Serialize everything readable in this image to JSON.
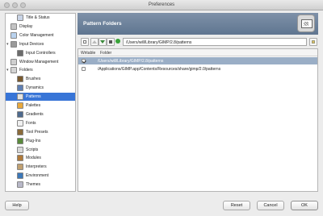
{
  "window": {
    "title": "Preferences"
  },
  "sidebar": {
    "items": [
      {
        "label": "Title & Status",
        "icon": "title-status-icon",
        "color": "#c9d4e6",
        "indent": 1,
        "toggle": ""
      },
      {
        "label": "Display",
        "icon": "display-icon",
        "color": "#c4c4c4",
        "indent": 0,
        "toggle": ""
      },
      {
        "label": "Color Management",
        "icon": "color-management-icon",
        "color": "#b9d2ee",
        "indent": 0,
        "toggle": ""
      },
      {
        "label": "Input Devices",
        "icon": "input-devices-icon",
        "color": "#9a9a9a",
        "indent": 0,
        "toggle": "▾"
      },
      {
        "label": "Input Controllers",
        "icon": "input-controllers-icon",
        "color": "#6b6b6b",
        "indent": 1,
        "toggle": ""
      },
      {
        "label": "Window Management",
        "icon": "window-management-icon",
        "color": "#cfcfcf",
        "indent": 0,
        "toggle": ""
      },
      {
        "label": "Folders",
        "icon": "folders-icon",
        "color": "#d4d4d4",
        "indent": 0,
        "toggle": "▾"
      },
      {
        "label": "Brushes",
        "icon": "brushes-icon",
        "color": "#7a5a2f",
        "indent": 1,
        "toggle": ""
      },
      {
        "label": "Dynamics",
        "icon": "dynamics-icon",
        "color": "#5f7fb3",
        "indent": 1,
        "toggle": ""
      },
      {
        "label": "Patterns",
        "icon": "patterns-icon",
        "color": "#e3e3e3",
        "indent": 1,
        "toggle": ""
      },
      {
        "label": "Palettes",
        "icon": "palettes-icon",
        "color": "#e8a83c",
        "indent": 1,
        "toggle": ""
      },
      {
        "label": "Gradients",
        "icon": "gradients-icon",
        "color": "#4e6a8e",
        "indent": 1,
        "toggle": ""
      },
      {
        "label": "Fonts",
        "icon": "fonts-icon",
        "color": "#f0f0f0",
        "indent": 1,
        "toggle": ""
      },
      {
        "label": "Tool Presets",
        "icon": "tool-presets-icon",
        "color": "#8a6a3a",
        "indent": 1,
        "toggle": ""
      },
      {
        "label": "Plug-Ins",
        "icon": "plug-ins-icon",
        "color": "#5a8a3c",
        "indent": 1,
        "toggle": ""
      },
      {
        "label": "Scripts",
        "icon": "scripts-icon",
        "color": "#d8d8d8",
        "indent": 1,
        "toggle": ""
      },
      {
        "label": "Modules",
        "icon": "modules-icon",
        "color": "#b07a3a",
        "indent": 1,
        "toggle": ""
      },
      {
        "label": "Interpreters",
        "icon": "interpreters-icon",
        "color": "#c0a070",
        "indent": 1,
        "toggle": ""
      },
      {
        "label": "Environment",
        "icon": "environment-icon",
        "color": "#3c78b8",
        "indent": 1,
        "toggle": ""
      },
      {
        "label": "Themes",
        "icon": "themes-icon",
        "color": "#b8b8c8",
        "indent": 1,
        "toggle": ""
      }
    ],
    "selected_index": 9
  },
  "header": {
    "title": "Pattern Folders",
    "icon": "patterns-header-icon"
  },
  "toolbar": {
    "path": "/Users/will/Library/GIMP/2.8/patterns",
    "buttons": [
      "new-folder-icon",
      "move-up-icon",
      "move-down-icon",
      "delete-folder-icon",
      "status-dot-icon"
    ],
    "browse_icon": "browse-folder-icon"
  },
  "table": {
    "headers": {
      "writable": "Writable",
      "folder": "Folder"
    },
    "rows": [
      {
        "writable": true,
        "folder": "/Users/will/Library/GIMP/2.8/patterns",
        "selected": true
      },
      {
        "writable": false,
        "folder": "/Applications/GIMP.app/Contents/Resources/share/gimp/2.0/patterns",
        "selected": false
      }
    ]
  },
  "buttons": {
    "help": "Help",
    "reset": "Reset",
    "cancel": "Cancel",
    "ok": "OK"
  },
  "colors": {
    "header_bg": "#6c809b",
    "selection": "#3875d7",
    "row_selection": "#9aaec6"
  }
}
